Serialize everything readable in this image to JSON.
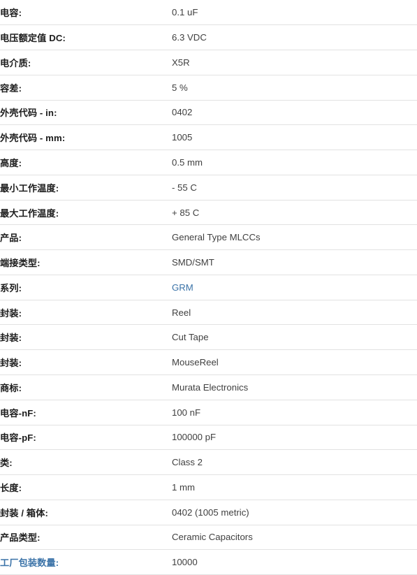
{
  "spec_table": {
    "rows": [
      {
        "label": "电容:",
        "value": "0.1 uF",
        "label_link": false,
        "value_link": false
      },
      {
        "label": "电压额定值 DC:",
        "value": "6.3 VDC",
        "label_link": false,
        "value_link": false
      },
      {
        "label": "电介质:",
        "value": "X5R",
        "label_link": false,
        "value_link": false
      },
      {
        "label": "容差:",
        "value": "5 %",
        "label_link": false,
        "value_link": false
      },
      {
        "label": "外壳代码 - in:",
        "value": "0402",
        "label_link": false,
        "value_link": false
      },
      {
        "label": "外壳代码 - mm:",
        "value": "1005",
        "label_link": false,
        "value_link": false
      },
      {
        "label": "高度:",
        "value": "0.5 mm",
        "label_link": false,
        "value_link": false
      },
      {
        "label": "最小工作温度:",
        "value": "- 55 C",
        "label_link": false,
        "value_link": false
      },
      {
        "label": "最大工作温度:",
        "value": "+ 85 C",
        "label_link": false,
        "value_link": false
      },
      {
        "label": "产品:",
        "value": "General Type MLCCs",
        "label_link": false,
        "value_link": false
      },
      {
        "label": "端接类型:",
        "value": "SMD/SMT",
        "label_link": false,
        "value_link": false
      },
      {
        "label": "系列:",
        "value": "GRM",
        "label_link": false,
        "value_link": true
      },
      {
        "label": "封装:",
        "value": "Reel",
        "label_link": false,
        "value_link": false
      },
      {
        "label": "封装:",
        "value": "Cut Tape",
        "label_link": false,
        "value_link": false
      },
      {
        "label": "封装:",
        "value": "MouseReel",
        "label_link": false,
        "value_link": false
      },
      {
        "label": "商标:",
        "value": "Murata Electronics",
        "label_link": false,
        "value_link": false
      },
      {
        "label": "电容-nF:",
        "value": "100 nF",
        "label_link": false,
        "value_link": false
      },
      {
        "label": "电容-pF:",
        "value": "100000 pF",
        "label_link": false,
        "value_link": false
      },
      {
        "label": "类:",
        "value": "Class 2",
        "label_link": false,
        "value_link": false
      },
      {
        "label": "长度:",
        "value": "1 mm",
        "label_link": false,
        "value_link": false
      },
      {
        "label": "封装 / 箱体:",
        "value": "0402 (1005 metric)",
        "label_link": false,
        "value_link": false
      },
      {
        "label": "产品类型:",
        "value": "Ceramic Capacitors",
        "label_link": false,
        "value_link": false
      },
      {
        "label": "工厂包装数量:",
        "value": "10000",
        "label_link": true,
        "value_link": false
      }
    ]
  },
  "colors": {
    "link": "#3b73a8",
    "label_text": "#1c1c1c",
    "value_text": "#3f3f3f",
    "row_divider": "#e2e2e2",
    "background": "#ffffff"
  }
}
